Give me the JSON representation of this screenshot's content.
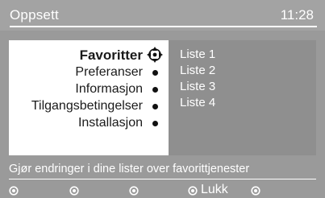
{
  "header": {
    "title": "Oppsett",
    "clock": "11:28"
  },
  "menu": {
    "items": [
      {
        "label": "Favoritter",
        "active": true
      },
      {
        "label": "Preferanser",
        "active": false
      },
      {
        "label": "Informasjon",
        "active": false
      },
      {
        "label": "Tilgangsbetingelser",
        "active": false
      },
      {
        "label": "Installasjon",
        "active": false
      }
    ]
  },
  "submenu": {
    "items": [
      {
        "label": "Liste 1"
      },
      {
        "label": "Liste 2"
      },
      {
        "label": "Liste 3"
      },
      {
        "label": "Liste 4"
      }
    ]
  },
  "hint": {
    "text": "Gjør endringer i dine lister over favorittjenester"
  },
  "softkeys": {
    "close_label": "Lukk",
    "icons": [
      "radio-bullet-icon",
      "radio-bullet-icon",
      "radio-bullet-icon",
      "radio-bullet-icon",
      "radio-bullet-icon"
    ]
  },
  "colors": {
    "screen_bg": "#9a9a9a",
    "panel_left": "#ffffff",
    "panel_right": "#8f8f8f",
    "text_dark": "#1a1a1a",
    "text_light": "#ffffff"
  }
}
